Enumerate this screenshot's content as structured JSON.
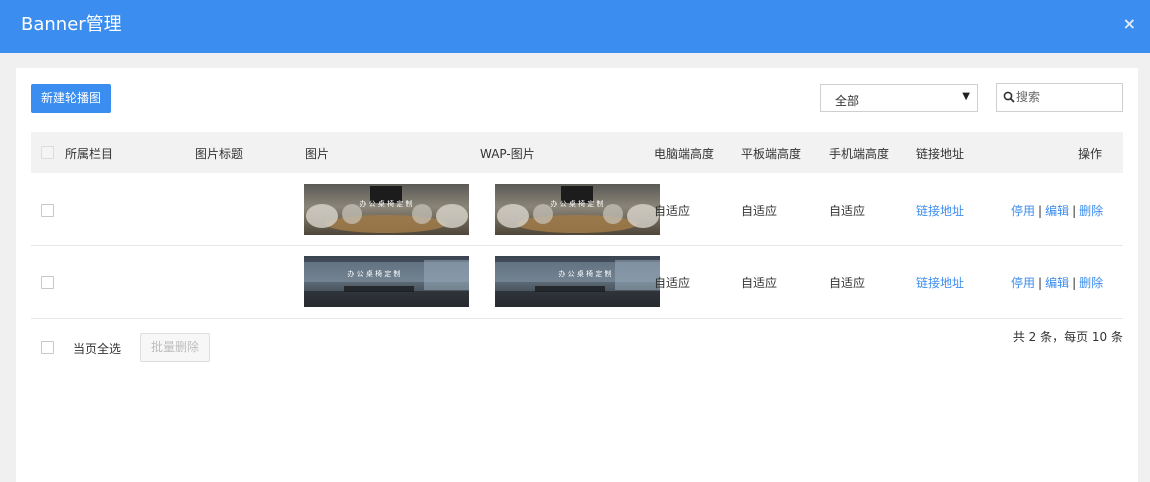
{
  "dialog": {
    "title": "Banner管理",
    "close_label": "×"
  },
  "toolbar": {
    "new_button": "新建轮播图",
    "filter_value": "全部",
    "filter_caret": "▼",
    "search_placeholder": "搜索"
  },
  "table": {
    "headers": [
      "所属栏目",
      "图片标题",
      "图片",
      "WAP-图片",
      "电脑端高度",
      "平板端高度",
      "手机端高度",
      "链接地址",
      "操作"
    ],
    "rows": [
      {
        "column": "",
        "title": "",
        "image_text": "办 公 桌 椅 定 制",
        "wap_image_text": "办 公 桌 椅 定 制",
        "pc_height": "自适应",
        "pad_height": "自适应",
        "mobile_height": "自适应",
        "link": "链接地址",
        "actions": {
          "disable": "停用",
          "edit": "编辑",
          "delete": "删除",
          "separator": "|"
        }
      },
      {
        "column": "",
        "title": "",
        "image_text": "办 公 桌 椅 定 制",
        "wap_image_text": "办 公 桌 椅 定 制",
        "pc_height": "自适应",
        "pad_height": "自适应",
        "mobile_height": "自适应",
        "link": "链接地址",
        "actions": {
          "disable": "停用",
          "edit": "编辑",
          "delete": "删除",
          "separator": "|"
        }
      }
    ]
  },
  "footer": {
    "select_all_label": "当页全选",
    "batch_delete": "批量删除",
    "total_text": "共 2 条，每页 10 条"
  },
  "colors": {
    "accent": "#3b8df0",
    "header_bg": "#3b8df0",
    "table_head_bg": "#f2f2f2"
  },
  "icons": {
    "search": "search-icon",
    "close": "close-icon",
    "caret": "caret-down-icon"
  }
}
